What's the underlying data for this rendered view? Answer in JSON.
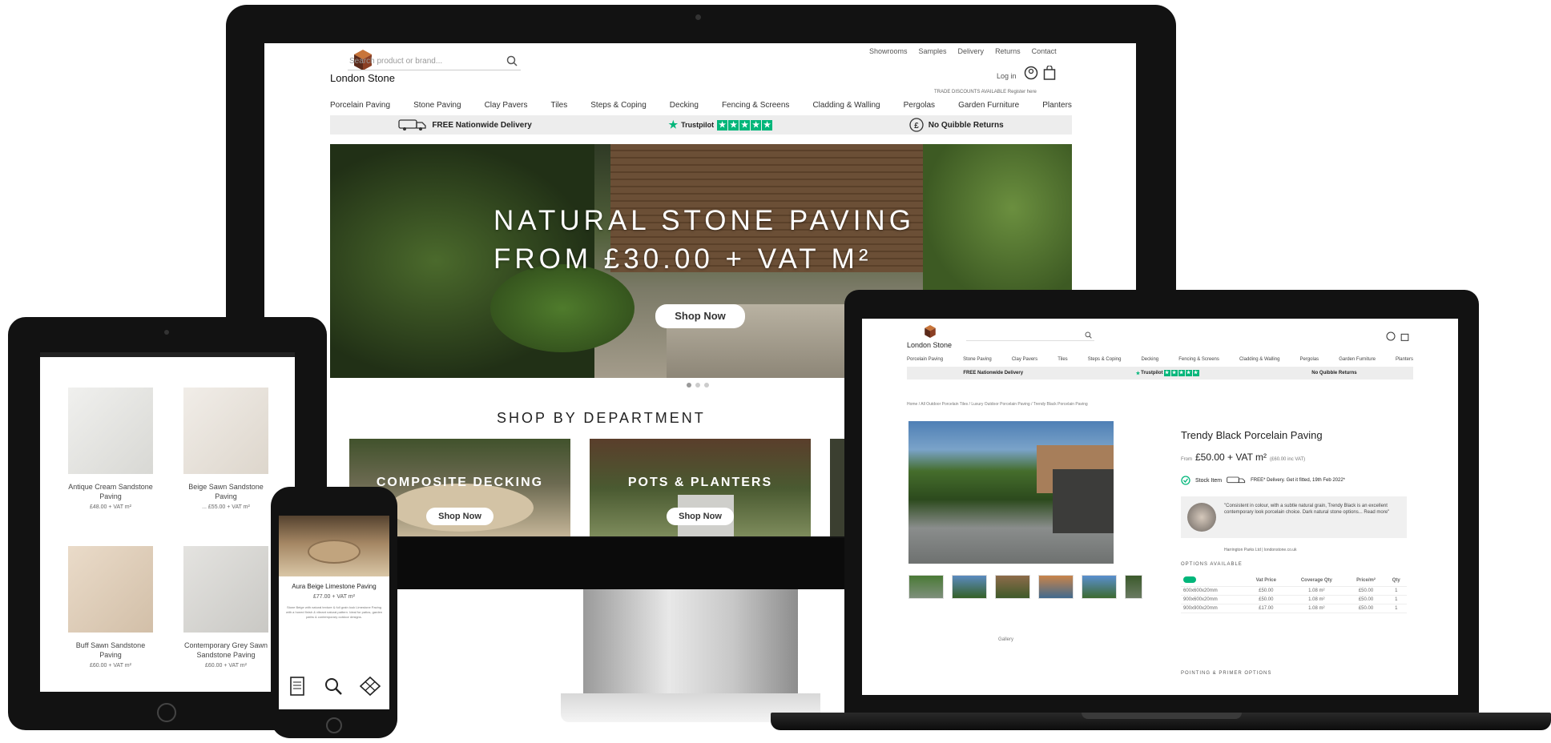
{
  "brand": {
    "name": "London Stone"
  },
  "desktop": {
    "top_links": [
      "Showrooms",
      "Samples",
      "Delivery",
      "Returns",
      "Contact"
    ],
    "search_placeholder": "Search product or brand...",
    "login": "Log in",
    "trade_note": "TRADE DISCOUNTS AVAILABLE Register here",
    "nav": [
      "Porcelain Paving",
      "Stone Paving",
      "Clay Pavers",
      "Tiles",
      "Steps & Coping",
      "Decking",
      "Fencing & Screens",
      "Cladding & Walling",
      "Pergolas",
      "Garden Furniture",
      "Planters"
    ],
    "delivery_text": "FREE Nationwide Delivery",
    "trustpilot": "Trustpilot",
    "returns_text": "No Quibble Returns",
    "hero_line1": "NATURAL STONE PAVING",
    "hero_line2": "FROM £30.00 + VAT M²",
    "hero_button": "Shop Now",
    "dept_heading": "SHOP BY DEPARTMENT",
    "departments": [
      {
        "title": "COMPOSITE DECKING",
        "button": "Shop Now"
      },
      {
        "title": "POTS & PLANTERS",
        "button": "Shop Now"
      }
    ]
  },
  "laptop": {
    "breadcrumb": "Home / All Outdoor Porcelain Tiles / Luxury Outdoor Porcelain Paving / Trendy Black Porcelain Paving",
    "product_title": "Trendy Black Porcelain Paving",
    "price_from": "From",
    "price": "£50.00 + VAT m²",
    "price_inc": "(£60.00 inc VAT)",
    "stock": "Stock Item",
    "delivery": "FREE* Delivery. Get it fitted, 19th Feb 2022*",
    "quote": "\"Consistent in colour, with a subtle natural grain, Trendy Black is an excellent contemporary look porcelain choice. Dark natural stone options... Read more\"",
    "quote_author": "Harrington Parks Ltd | londonstone.co.uk",
    "options_heading": "OPTIONS AVAILABLE",
    "options_headers": [
      "",
      "Vat Price",
      "Coverage Qty",
      "Price/m²",
      "Qty"
    ],
    "options_rows": [
      [
        "600x600x20mm",
        "£50.00",
        "1.08 m²",
        "£50.00",
        "1"
      ],
      [
        "900x600x20mm",
        "£50.00",
        "1.08 m²",
        "£50.00",
        "1"
      ],
      [
        "900x900x20mm",
        "£17.00",
        "1.08 m²",
        "£50.00",
        "1"
      ]
    ],
    "thumbs_caption": "Gallery",
    "pointing_heading": "POINTING & PRIMER OPTIONS"
  },
  "tablet": {
    "products": [
      {
        "name": "Antique Cream Sandstone Paving",
        "price": "£48.00 + VAT m²"
      },
      {
        "name": "Beige Sawn Sandstone Paving",
        "price": "... £55.00 + VAT m²"
      },
      {
        "name": "Buff Sawn Sandstone Paving",
        "price": "£60.00 + VAT m²"
      },
      {
        "name": "Contemporary Grey Sawn Sandstone Paving",
        "price": "£60.00 + VAT m²"
      }
    ]
  },
  "phone": {
    "product_title": "Aura Beige Limestone Paving",
    "price": "£77.00 + VAT m²",
    "body": "Stone Beige with natural texture & full grain look Limestone Paving with a honed finish & vibrant natural pattern. Ideal for patios, garden paths & contemporary outdoor designs."
  },
  "colors": {
    "accent_green": "#00b67a",
    "device_black": "#121212",
    "text_dark": "#222222"
  }
}
